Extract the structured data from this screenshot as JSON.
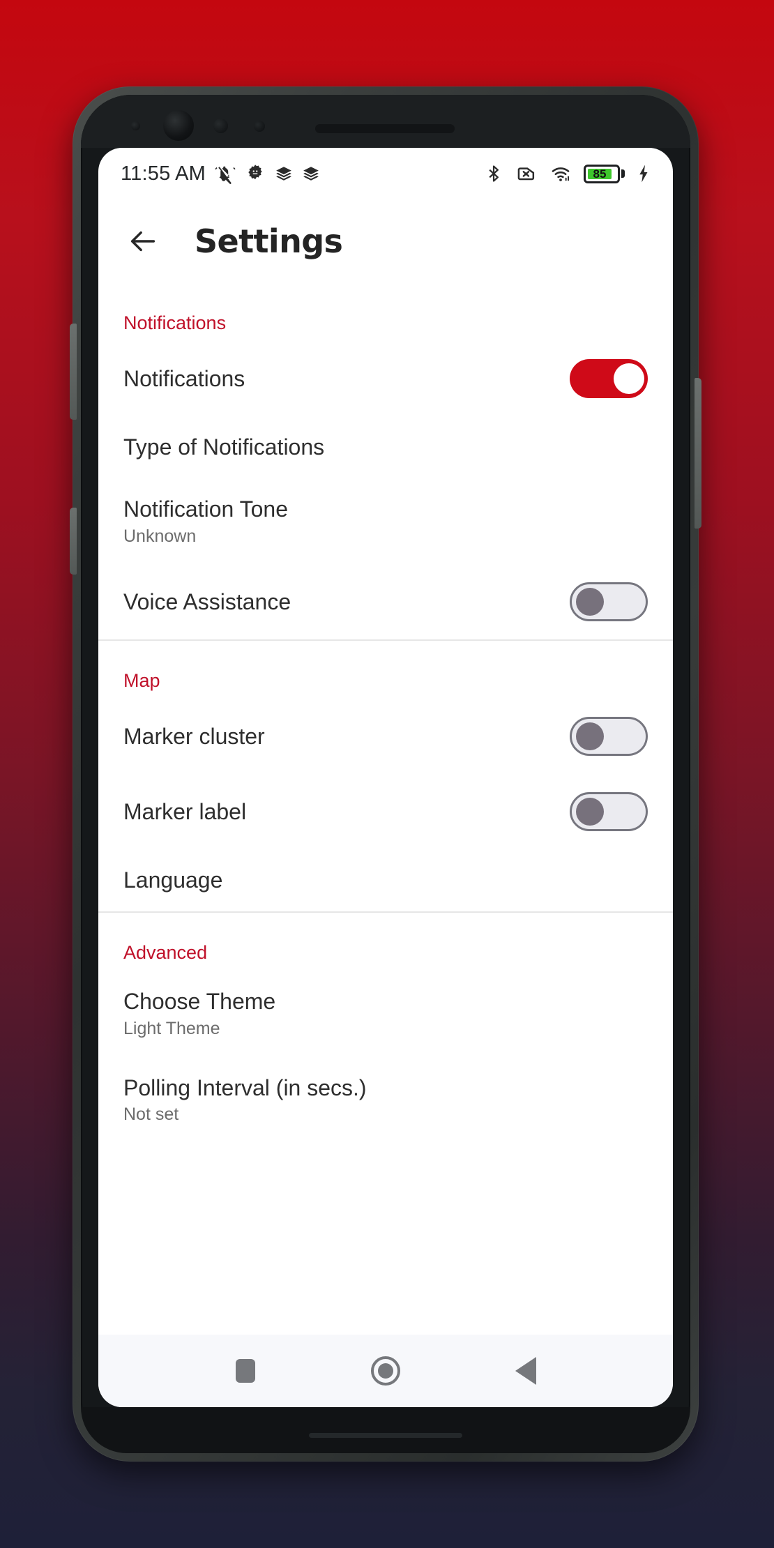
{
  "status_bar": {
    "time": "11:55 AM",
    "left_icons": [
      "vibrate-off-icon",
      "android-gear-icon",
      "layers-icon",
      "layers-icon"
    ],
    "right_icons": [
      "bluetooth-icon",
      "no-sim-icon",
      "wifi-icon",
      "battery-icon",
      "charging-bolt-icon"
    ],
    "battery_percent": "85"
  },
  "app_bar": {
    "back_icon": "arrow-left-icon",
    "title": "Settings"
  },
  "colors": {
    "accent_red": "#c0112a",
    "toggle_on": "#cf0a18",
    "toggle_off_track": "#ebebf0",
    "battery_green": "#3ec72c",
    "background_top": "#c4070f",
    "background_bottom": "#1e2038"
  },
  "sections": [
    {
      "header": "Notifications",
      "rows": [
        {
          "title": "Notifications",
          "subtitle": "",
          "control": "toggle",
          "state": "on"
        },
        {
          "title": "Type of Notifications",
          "subtitle": "",
          "control": "none",
          "state": ""
        },
        {
          "title": "Notification Tone",
          "subtitle": "Unknown",
          "control": "none",
          "state": ""
        },
        {
          "title": "Voice Assistance",
          "subtitle": "",
          "control": "toggle",
          "state": "off"
        }
      ]
    },
    {
      "header": "Map",
      "rows": [
        {
          "title": "Marker cluster",
          "subtitle": "",
          "control": "toggle",
          "state": "off"
        },
        {
          "title": "Marker label",
          "subtitle": "",
          "control": "toggle",
          "state": "off"
        },
        {
          "title": "Language",
          "subtitle": "",
          "control": "none",
          "state": ""
        }
      ]
    },
    {
      "header": "Advanced",
      "rows": [
        {
          "title": "Choose Theme",
          "subtitle": "Light Theme",
          "control": "none",
          "state": ""
        },
        {
          "title": "Polling Interval (in secs.)",
          "subtitle": "Not set",
          "control": "none",
          "state": ""
        }
      ]
    }
  ],
  "nav_bar": {
    "recents_label": "recents-square-icon",
    "home_label": "home-circle-icon",
    "back_label": "back-triangle-icon"
  }
}
